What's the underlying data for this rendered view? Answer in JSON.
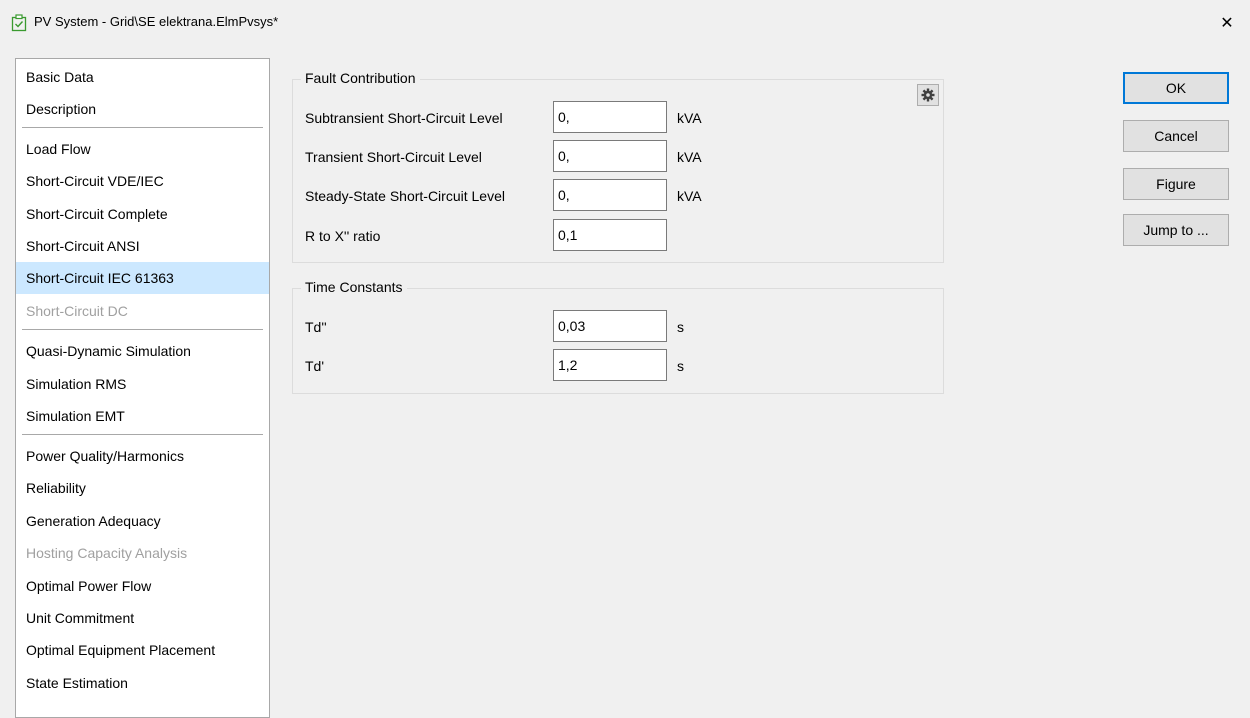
{
  "window": {
    "title": "PV System - Grid\\SE elektrana.ElmPvsys*",
    "close_glyph": "✕"
  },
  "sidebar": {
    "items": [
      {
        "label": "Basic Data"
      },
      {
        "label": "Description"
      },
      {
        "label": "Load Flow"
      },
      {
        "label": "Short-Circuit VDE/IEC"
      },
      {
        "label": "Short-Circuit Complete"
      },
      {
        "label": "Short-Circuit ANSI"
      },
      {
        "label": "Short-Circuit IEC 61363",
        "selected": true
      },
      {
        "label": "Short-Circuit DC",
        "disabled": true
      },
      {
        "label": "Quasi-Dynamic Simulation"
      },
      {
        "label": "Simulation RMS"
      },
      {
        "label": "Simulation EMT"
      },
      {
        "label": "Power Quality/Harmonics"
      },
      {
        "label": "Reliability"
      },
      {
        "label": "Generation Adequacy"
      },
      {
        "label": "Hosting Capacity Analysis",
        "disabled": true
      },
      {
        "label": "Optimal Power Flow"
      },
      {
        "label": "Unit Commitment"
      },
      {
        "label": "Optimal Equipment Placement"
      },
      {
        "label": "State Estimation"
      }
    ]
  },
  "fault_contribution": {
    "title": "Fault Contribution",
    "fields": [
      {
        "label": "Subtransient Short-Circuit Level",
        "value": "0,",
        "unit": "kVA"
      },
      {
        "label": "Transient Short-Circuit Level",
        "value": "0,",
        "unit": "kVA"
      },
      {
        "label": "Steady-State Short-Circuit Level",
        "value": "0,",
        "unit": "kVA"
      },
      {
        "label": "R to X'' ratio",
        "value": "0,1",
        "unit": ""
      }
    ]
  },
  "time_constants": {
    "title": "Time Constants",
    "fields": [
      {
        "label": "Td''",
        "value": "0,03",
        "unit": "s"
      },
      {
        "label": "Td'",
        "value": "1,2",
        "unit": "s"
      }
    ]
  },
  "buttons": {
    "ok": "OK",
    "cancel": "Cancel",
    "figure": "Figure",
    "jump_to": "Jump to ..."
  },
  "colors": {
    "selected_bg": "#cce8ff",
    "disabled_text": "#a0a0a0",
    "default_button_border": "#0078d7"
  }
}
